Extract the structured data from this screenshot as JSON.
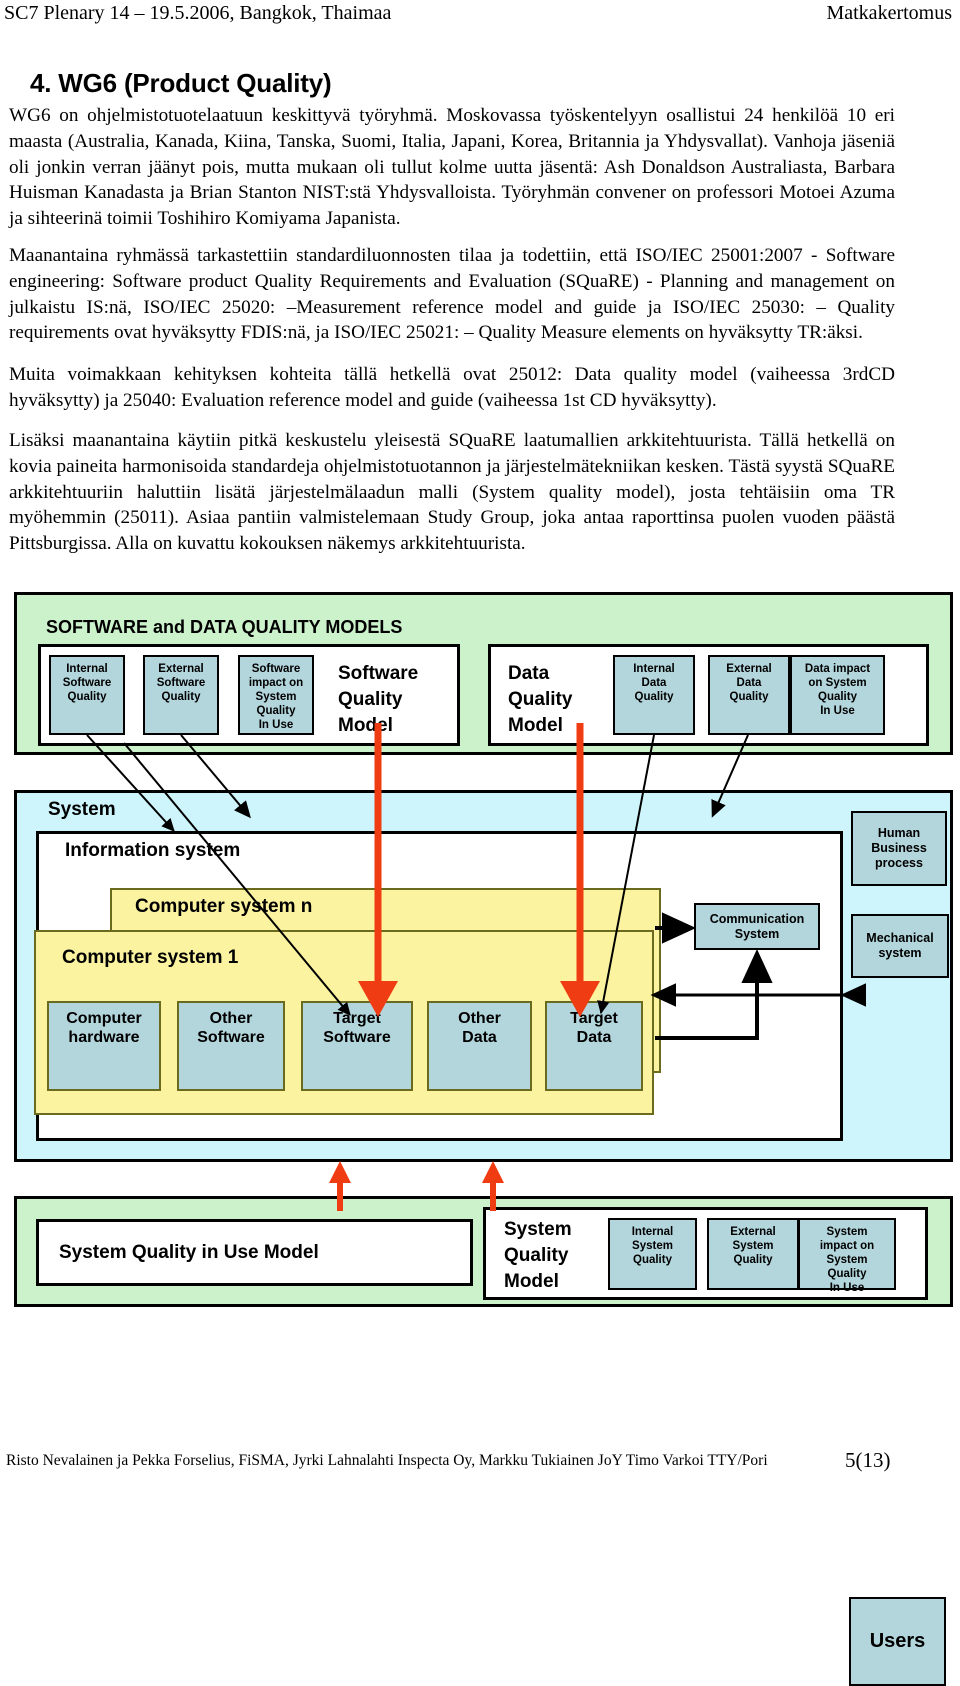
{
  "header": {
    "left": "SC7 Plenary 14 – 19.5.2006, Bangkok, Thaimaa",
    "right": "Matkakertomus"
  },
  "title": "4. WG6 (Product Quality)",
  "paragraphs": {
    "p1": "WG6 on ohjelmistotuotelaatuun keskittyvä työryhmä. Moskovassa työskentelyyn osallistui 24 henkilöä 10 eri maasta (Australia, Kanada, Kiina, Tanska, Suomi, Italia, Japani, Korea, Britannia ja Yhdysvallat). Vanhoja jäseniä oli jonkin verran jäänyt pois, mutta mukaan oli tullut kolme uutta jäsentä: Ash Donaldson Australiasta, Barbara Huisman Kanadasta ja Brian Stanton NIST:stä Yhdysvalloista. Työryhmän convener on professori Motoei Azuma ja sihteerinä toimii Toshihiro Komiyama Japanista.",
    "p2": "Maanantaina ryhmässä tarkastettiin standardiluonnosten tilaa ja todettiin, että ISO/IEC 25001:2007 - Software engineering: Software product Quality Requirements and Evaluation (SQuaRE) - Planning and management on julkaistu IS:nä, ISO/IEC 25020: –Measurement reference model and guide ja ISO/IEC 25030: – Quality requirements ovat hyväksytty FDIS:nä, ja ISO/IEC 25021: – Quality Measure elements on hyväksytty TR:äksi.",
    "p3": "Muita voimakkaan kehityksen kohteita tällä hetkellä ovat 25012: Data quality model (vaiheessa 3rdCD hyväksytty) ja 25040: Evaluation reference model and guide (vaiheessa 1st CD hyväksytty).",
    "p4": "Lisäksi maanantaina käytiin pitkä keskustelu yleisestä SQuaRE laatumallien arkkitehtuurista. Tällä hetkellä on kovia paineita harmonisoida standardeja ohjelmistotuotannon ja järjestelmätekniikan kesken. Tästä syystä SQuaRE arkkitehtuuriin haluttiin lisätä järjestelmälaadun malli (System quality model), josta tehtäisiin oma TR myöhemmin (25011). Asiaa pantiin valmistelemaan Study Group, joka antaa raporttinsa puolen vuoden päästä Pittsburgissa. Alla on kuvattu kokouksen näkemys arkkitehtuurista."
  },
  "diagram": {
    "top_panel": {
      "title": "SOFTWARE and DATA QUALITY MODELS",
      "software_group": {
        "model_label": "Software\nQuality\nModel",
        "cells": [
          "Internal\nSoftware\nQuality",
          "External\nSoftware\nQuality",
          "Software\nimpact on\nSystem\nQuality\nIn Use"
        ]
      },
      "data_group": {
        "model_label": "Data\nQuality\nModel",
        "cells": [
          "Internal\nData\nQuality",
          "External\nData\nQuality",
          "Data impact\non System\nQuality\nIn Use"
        ]
      }
    },
    "system_panel": {
      "system_label": "System",
      "information_system_label": "Information system",
      "computer_system_n_label": "Computer system n",
      "computer_system_1_label": "Computer system 1",
      "leaf_cells": [
        "Computer\nhardware",
        "Other\nSoftware",
        "Target\nSoftware",
        "Other\nData",
        "Target\nData"
      ],
      "communication_system_label": "Communication\nSystem",
      "human_business_process_label": "Human\nBusiness\nprocess",
      "mechanical_system_label": "Mechanical\nsystem",
      "users_label": "Users"
    },
    "bottom_panel": {
      "quality_in_use_label": "System Quality in Use Model",
      "system_model_label": "System\nQuality\nModel",
      "cells": [
        "Internal\nSystem\nQuality",
        "External\nSystem\nQuality",
        "System\nimpact on\nSystem\nQuality\nIn Use"
      ]
    },
    "colors": {
      "green_panel": "#ccf2cc",
      "blue_cell": "#b3d6dd",
      "system_panel": "#cdf5fb",
      "computer_system": "#fbf3a0",
      "red_arrow": "#f03c12"
    }
  },
  "footer": {
    "authors": "Risto Nevalainen ja Pekka Forselius, FiSMA, Jyrki Lahnalahti Inspecta Oy, Markku Tukiainen JoY Timo Varkoi TTY/Pori",
    "page": "5(13)"
  }
}
